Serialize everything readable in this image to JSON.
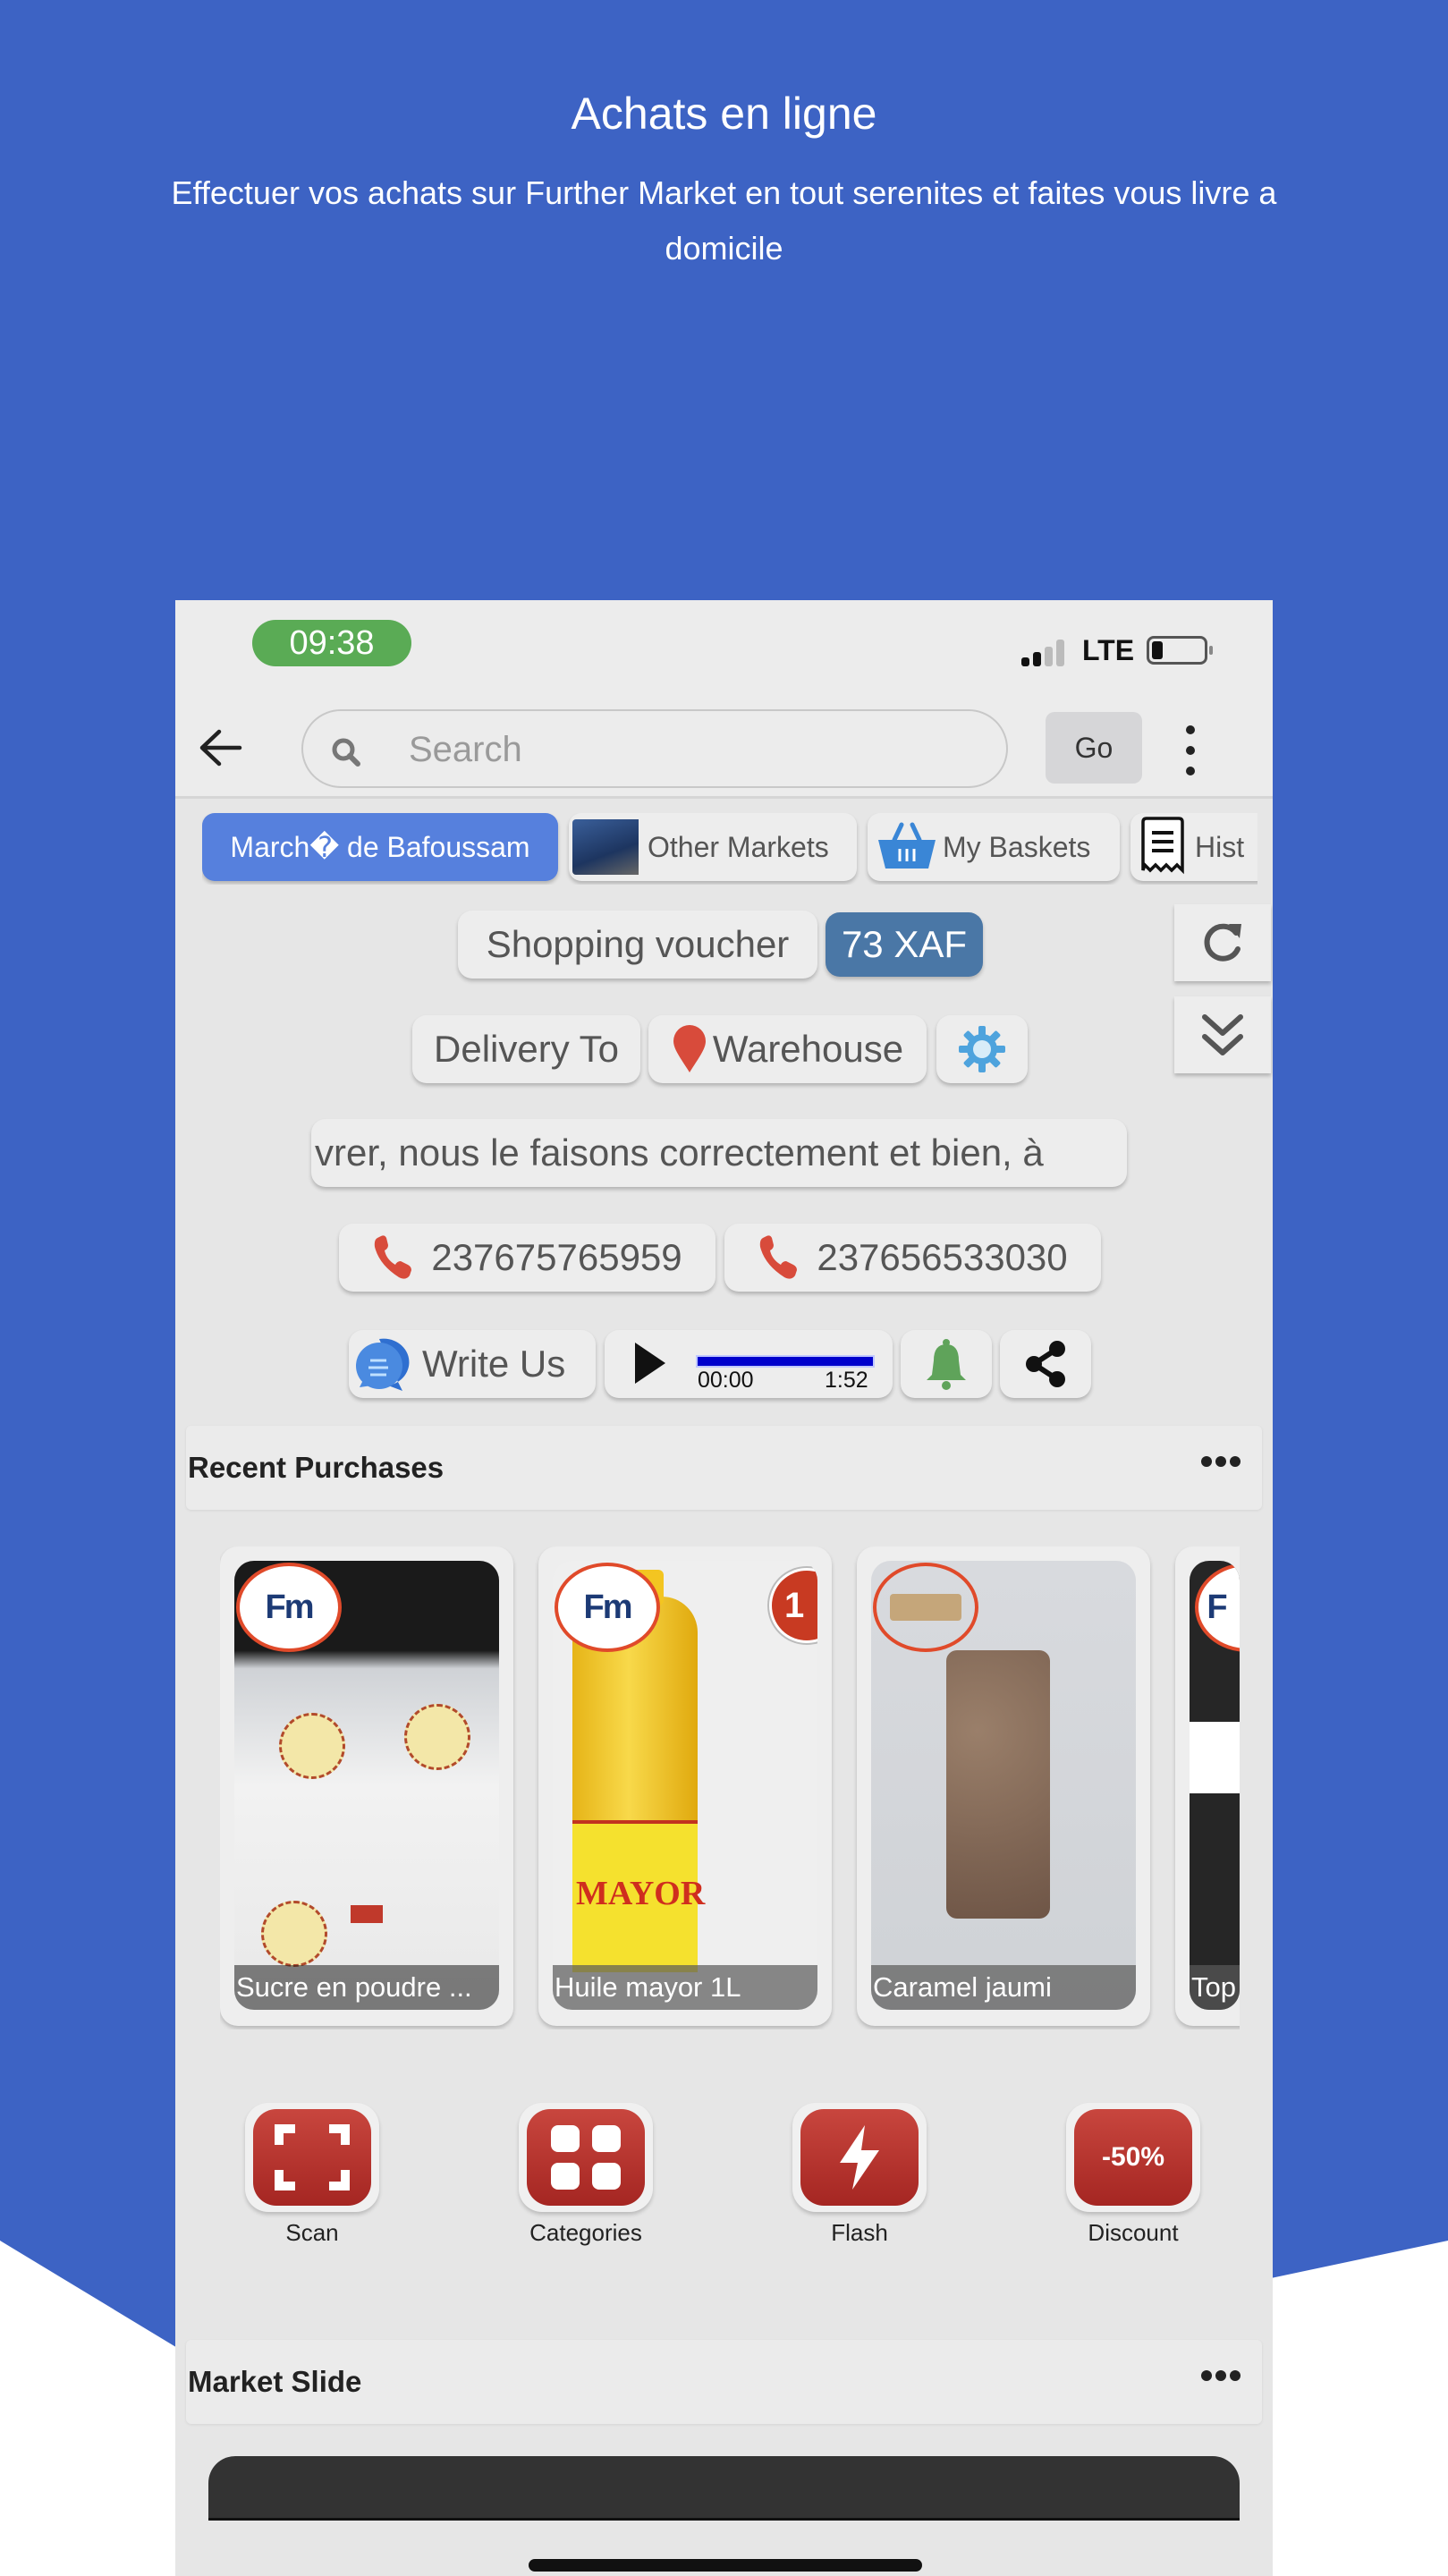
{
  "promo": {
    "title": "Achats en ligne",
    "subtitle": "Effectuer vos achats sur Further Market en tout serenites et faites vous livre a domicile",
    "brand_color": "#3d63c4"
  },
  "status_bar": {
    "time": "09:38",
    "network": "LTE",
    "battery_level": 0.15
  },
  "toolbar": {
    "back_icon": "arrow-left-icon",
    "search_placeholder": "Search",
    "search_value": "",
    "go_label": "Go",
    "menu_icon": "more-vertical-icon"
  },
  "chips": [
    {
      "label": "March� de Bafoussam",
      "active": true,
      "icon": null
    },
    {
      "label": "Other Markets",
      "active": false,
      "icon": "market-photo"
    },
    {
      "label": "My Baskets",
      "active": false,
      "icon": "basket-icon"
    },
    {
      "label": "Hist",
      "active": false,
      "icon": "receipt-icon"
    }
  ],
  "voucher": {
    "label": "Shopping voucher",
    "value": "73 XAF"
  },
  "delivery": {
    "label": "Delivery To",
    "location": "Warehouse",
    "settings_icon": "gear-icon"
  },
  "ticker": {
    "text": "vrer, nous le faisons correctement et bien, à"
  },
  "phones": [
    "237675765959",
    "237656533030"
  ],
  "actions_row": {
    "write_us": "Write Us",
    "audio": {
      "current": "00:00",
      "duration": "1:52",
      "progress": 0
    },
    "bell_icon": "bell-icon",
    "share_icon": "share-icon"
  },
  "side_buttons": {
    "refresh_icon": "refresh-icon",
    "expand_icon": "chevrons-down-icon"
  },
  "recent_purchases": {
    "title": "Recent Purchases",
    "items": [
      {
        "name": "Sucre en poudre ...",
        "logo": "Fm",
        "badge": null
      },
      {
        "name": "Huile mayor 1L",
        "logo": "Fm",
        "badge": "1"
      },
      {
        "name": "Caramel jaumi",
        "logo": null,
        "badge": null
      },
      {
        "name": "Top",
        "logo": "F",
        "badge": null
      }
    ]
  },
  "quick_actions": [
    {
      "label": "Scan",
      "icon": "scan-icon"
    },
    {
      "label": "Categories",
      "icon": "grid-icon"
    },
    {
      "label": "Flash",
      "icon": "lightning-icon"
    },
    {
      "label": "Discount",
      "icon": "discount-icon",
      "icon_text": "-50%"
    }
  ],
  "market_slide": {
    "title": "Market Slide"
  }
}
